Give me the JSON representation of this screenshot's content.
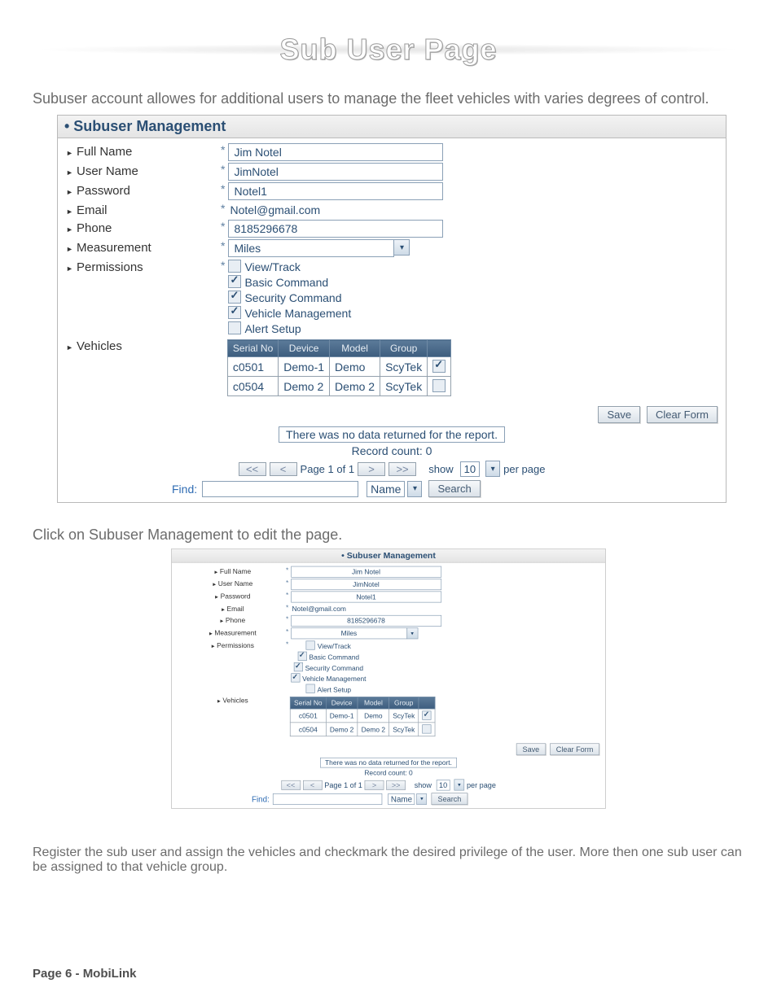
{
  "page_title": "Sub User Page",
  "intro_text": "Subuser account allowes for additional users to manage the fleet vehicles with varies degrees of control.",
  "caption1": "Click on Subuser Management to edit the page.",
  "caption2": "Register the sub user and assign the vehicles and checkmark the desired privilege of the user. More then one sub user can be assigned to that vehicle group.",
  "footer": "Page 6  -  MobiLink",
  "panel": {
    "header": "• Subuser Management",
    "fields": {
      "full_name_label": "Full Name",
      "full_name_value": "Jim Notel",
      "user_name_label": "User Name",
      "user_name_value": "JimNotel",
      "password_label": "Password",
      "password_value": "Notel1",
      "email_label": "Email",
      "email_value": "Notel@gmail.com",
      "phone_label": "Phone",
      "phone_value": "8185296678",
      "measurement_label": "Measurement",
      "measurement_value": "Miles",
      "permissions_label": "Permissions",
      "permissions": {
        "view_track": "View/Track",
        "basic_command": "Basic Command",
        "security_command": "Security Command",
        "vehicle_management": "Vehicle Management",
        "alert_setup": "Alert Setup"
      },
      "vehicles_label": "Vehicles",
      "vehicle_headers": {
        "serial": "Serial No",
        "device": "Device",
        "model": "Model",
        "group": "Group",
        "check": " "
      },
      "vehicle_rows": [
        {
          "serial": "c0501",
          "device": "Demo-1",
          "model": "Demo",
          "group": "ScyTek",
          "checked": true
        },
        {
          "serial": "c0504",
          "device": "Demo 2",
          "model": "Demo 2",
          "group": "ScyTek",
          "checked": false
        }
      ]
    },
    "buttons": {
      "save": "Save",
      "clear": "Clear Form",
      "search": "Search"
    },
    "status_text": "There was no data returned for the report.",
    "record_count": "Record count: 0",
    "pager": {
      "first": "<<",
      "prev": "<",
      "text": "Page 1 of 1",
      "next": ">",
      "last": ">>",
      "show": "show",
      "per_page_value": "10",
      "per_page_label": "per page"
    },
    "find": {
      "label": "Find:",
      "field": "Name"
    }
  },
  "chart_data": {
    "type": "table",
    "title": "Vehicles",
    "columns": [
      "Serial No",
      "Device",
      "Model",
      "Group",
      "Checked"
    ],
    "rows": [
      [
        "c0501",
        "Demo-1",
        "Demo",
        "ScyTek",
        true
      ],
      [
        "c0504",
        "Demo 2",
        "Demo 2",
        "ScyTek",
        false
      ]
    ]
  }
}
